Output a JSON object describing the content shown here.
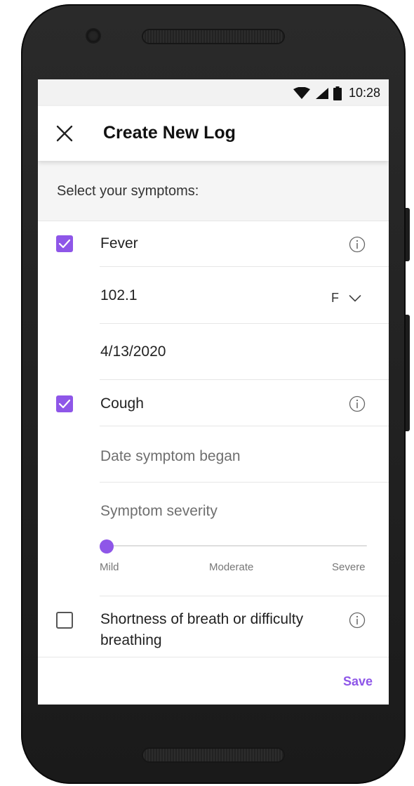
{
  "status_bar": {
    "time": "10:28"
  },
  "app_bar": {
    "title": "Create New Log"
  },
  "section": {
    "header": "Select your symptoms:"
  },
  "symptoms": [
    {
      "label": "Fever",
      "checked": true,
      "temperature_value": "102.1",
      "temperature_unit": "F",
      "date_value": "4/13/2020"
    },
    {
      "label": "Cough",
      "checked": true,
      "date_placeholder": "Date symptom began",
      "severity_label": "Symptom severity",
      "severity_fraction": 0.0,
      "severity_scale": [
        "Mild",
        "Moderate",
        "Severe"
      ]
    },
    {
      "label_line1": "Shortness of breath or difficulty",
      "label_line2": "breathing",
      "checked": false
    }
  ],
  "footer": {
    "save_label": "Save"
  },
  "colors": {
    "accent": "#8e56e8"
  },
  "icons": [
    "wifi-icon",
    "signal-icon",
    "battery-icon",
    "close-icon",
    "check-icon",
    "info-icon",
    "chevron-down-icon"
  ]
}
